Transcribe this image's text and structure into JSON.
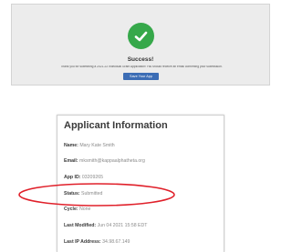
{
  "success": {
    "icon": "check-icon",
    "title": "Success!",
    "message": "Thank you for submitting a 2021-22 Individual Grant Application! You should receive an email confirming your submission.",
    "save_button_label": "Save Your App"
  },
  "applicant": {
    "title": "Applicant Information",
    "fields": [
      {
        "label": "Name:",
        "value": "Mary Kate Smith"
      },
      {
        "label": "Email:",
        "value": "mksmith@kappaalphatheta.org"
      },
      {
        "label": "App ID:",
        "value": "03209265"
      },
      {
        "label": "Status:",
        "value": "Submitted"
      },
      {
        "label": "Cycle:",
        "value": "None"
      },
      {
        "label": "Last Modified:",
        "value": "Jun 04 2021 15:58 EDT"
      },
      {
        "label": "Last IP Address:",
        "value": "34.98.67.149"
      }
    ]
  },
  "colors": {
    "success_green": "#36a84a",
    "button_blue": "#3c6db5",
    "annotation_red": "#e0202a"
  }
}
